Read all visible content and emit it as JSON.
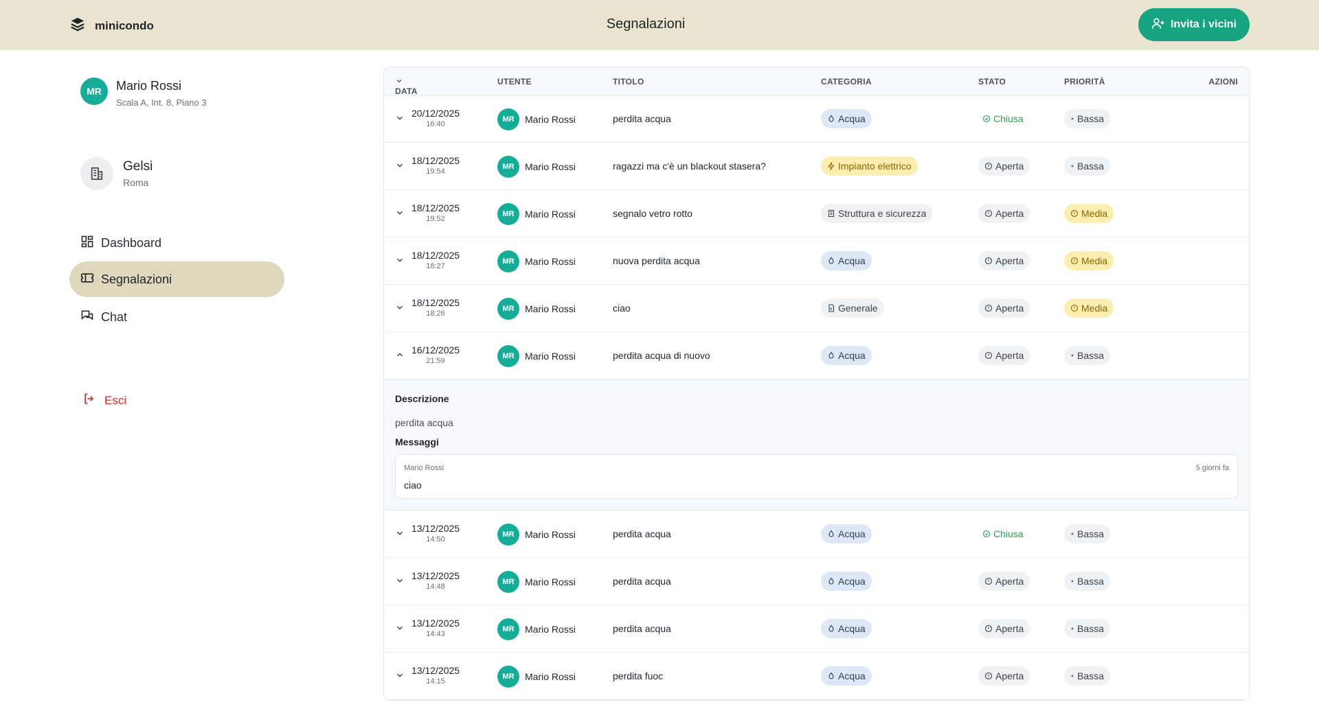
{
  "header": {
    "brand": "minicondo",
    "title": "Segnalazioni",
    "invite_label": "Invita i vicini"
  },
  "sidebar": {
    "user": {
      "initials": "MR",
      "name": "Mario Rossi",
      "address": "Scala A, Int. 8, Piano 3"
    },
    "building": {
      "name": "Gelsi",
      "city": "Roma"
    },
    "nav": [
      {
        "label": "Dashboard",
        "icon": "dashboard-icon"
      },
      {
        "label": "Segnalazioni",
        "icon": "ticket-icon",
        "active": true
      },
      {
        "label": "Chat",
        "icon": "chat-icon"
      }
    ],
    "logout_label": "Esci"
  },
  "table": {
    "headers": {
      "data": "DATA",
      "utente": "UTENTE",
      "titolo": "TITOLO",
      "categoria": "CATEGORIA",
      "stato": "STATO",
      "priorita": "PRIORITÀ",
      "azioni": "AZIONI"
    },
    "rows": [
      {
        "date": "20/12/2025",
        "time": "16:40",
        "initials": "MR",
        "user": "Mario Rossi",
        "title": "perdita acqua",
        "category": "Acqua",
        "status": "Chiusa",
        "priority": "Bassa"
      },
      {
        "date": "18/12/2025",
        "time": "19:54",
        "initials": "MR",
        "user": "Mario Rossi",
        "title": "ragazzi ma c'è un blackout stasera?",
        "category": "Impianto elettrico",
        "status": "Aperta",
        "priority": "Bassa"
      },
      {
        "date": "18/12/2025",
        "time": "19:52",
        "initials": "MR",
        "user": "Mario Rossi",
        "title": "segnalo vetro rotto",
        "category": "Struttura e sicurezza",
        "status": "Aperta",
        "priority": "Media"
      },
      {
        "date": "18/12/2025",
        "time": "18:27",
        "initials": "MR",
        "user": "Mario Rossi",
        "title": "nuova perdita acqua",
        "category": "Acqua",
        "status": "Aperta",
        "priority": "Media"
      },
      {
        "date": "18/12/2025",
        "time": "18:26",
        "initials": "MR",
        "user": "Mario Rossi",
        "title": "ciao",
        "category": "Generale",
        "status": "Aperta",
        "priority": "Media"
      },
      {
        "date": "16/12/2025",
        "time": "21:59",
        "initials": "MR",
        "user": "Mario Rossi",
        "title": "perdita acqua di nuovo",
        "category": "Acqua",
        "status": "Aperta",
        "priority": "Bassa"
      },
      {
        "date": "13/12/2025",
        "time": "14:50",
        "initials": "MR",
        "user": "Mario Rossi",
        "title": "perdita acqua",
        "category": "Acqua",
        "status": "Chiusa",
        "priority": "Bassa"
      },
      {
        "date": "13/12/2025",
        "time": "14:48",
        "initials": "MR",
        "user": "Mario Rossi",
        "title": "perdita acqua",
        "category": "Acqua",
        "status": "Aperta",
        "priority": "Bassa"
      },
      {
        "date": "13/12/2025",
        "time": "14:43",
        "initials": "MR",
        "user": "Mario Rossi",
        "title": "perdita acqua",
        "category": "Acqua",
        "status": "Aperta",
        "priority": "Bassa"
      },
      {
        "date": "13/12/2025",
        "time": "14:15",
        "initials": "MR",
        "user": "Mario Rossi",
        "title": "perdita fuoc",
        "category": "Acqua",
        "status": "Aperta",
        "priority": "Bassa"
      }
    ],
    "expanded": {
      "description_label": "Descrizione",
      "description": "perdita acqua",
      "messages_label": "Messaggi",
      "message": {
        "author": "Mario Rossi",
        "time": "5 giorni fa",
        "text": "ciao"
      }
    }
  },
  "colors": {
    "header_bg": "#e9e4cf",
    "accent": "#16a37f",
    "avatar": "#16ad98",
    "nav_active": "#e0d8bd",
    "logout": "#d42b2b"
  }
}
